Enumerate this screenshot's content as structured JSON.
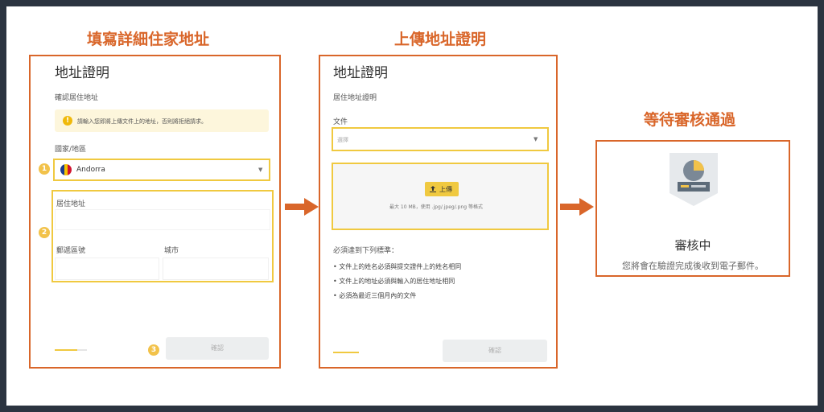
{
  "steps": [
    {
      "title": "填寫詳細住家地址"
    },
    {
      "title": "上傳地址證明"
    },
    {
      "title": "等待審核通過"
    }
  ],
  "panel1": {
    "heading": "地址證明",
    "subheading": "確認居住地址",
    "notice": "請輸入您即將上傳文件上的地址，否則將拒絕請求。",
    "country_label": "國家/地區",
    "country_value": "Andorra",
    "address_label": "居住地址",
    "postal_label": "郵遞區號",
    "city_label": "城市",
    "badges": [
      "1",
      "2",
      "3"
    ],
    "confirm_label": "確認"
  },
  "panel2": {
    "heading": "地址證明",
    "subheading": "居住地址證明",
    "doc_label": "文件",
    "doc_placeholder": "選擇",
    "upload_label": "上傳",
    "upload_hint": "最大 10 MB，使用 .jpg/.jpeg/.png 等格式",
    "requirements_title": "必須達到下列標準：",
    "requirements": [
      "文件上的姓名必須與提交證件上的姓名相同",
      "文件上的地址必須與輸入的居住地址相同",
      "必須為最近三個月內的文件"
    ],
    "confirm_label": "確認"
  },
  "panel3": {
    "status_title": "審核中",
    "status_message": "您將會在驗證完成後收到電子郵件。"
  },
  "colors": {
    "accent_orange": "#d9662a",
    "highlight_yellow": "#f0c940",
    "brand_yellow": "#f0b90b",
    "notice_bg": "#fdf6dc"
  },
  "icons": [
    "warning-icon",
    "andorra-flag-icon",
    "chevron-down-icon",
    "upload-icon",
    "arrow-right-icon",
    "review-badge-icon"
  ]
}
